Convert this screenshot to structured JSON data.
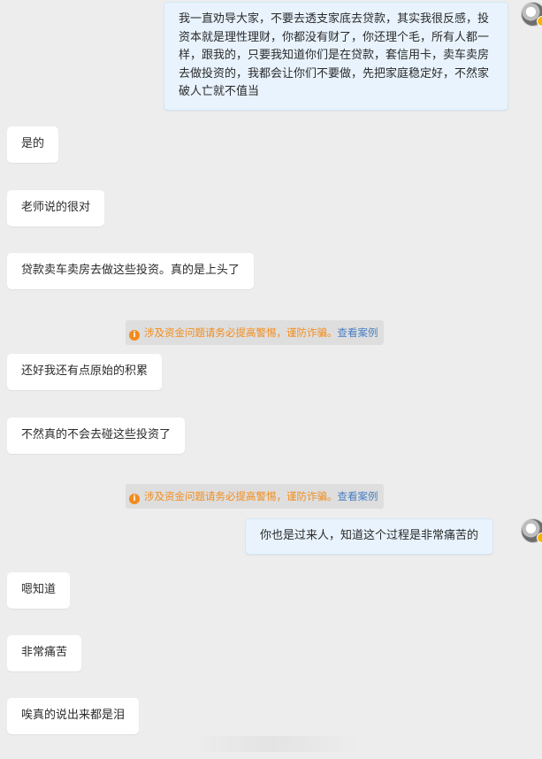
{
  "messages": [
    {
      "side": "right",
      "text": "我一直劝导大家，不要去透支家底去贷款，其实我很反感，投资本就是理性理财，你都没有财了，你还理个毛，所有人都一样，跟我的，只要我知道你们是在贷款，套信用卡，卖车卖房去做投资的，我都会让你们不要做，先把家庭稳定好，不然家破人亡就不值当"
    },
    {
      "side": "left",
      "text": "是的"
    },
    {
      "side": "left",
      "text": "老师说的很对"
    },
    {
      "side": "left",
      "text": "贷款卖车卖房去做这些投资。真的是上头了"
    },
    {
      "side": "left",
      "text": "还好我还有点原始的积累"
    },
    {
      "side": "left",
      "text": "不然真的不会去碰这些投资了"
    },
    {
      "side": "right",
      "text": "你也是过来人，知道这个过程是非常痛苦的"
    },
    {
      "side": "left",
      "text": "嗯知道"
    },
    {
      "side": "left",
      "text": "非常痛苦"
    },
    {
      "side": "left",
      "text": "唉真的说出来都是泪"
    }
  ],
  "notice": {
    "text": "涉及资金问题请务必提高警惕，谨防诈骗。",
    "link": "查看案例",
    "icon": "info-icon",
    "color": "#f28c1c",
    "link_color": "#4a7fc1"
  },
  "colors": {
    "background": "#ededed",
    "left_bubble": "#ffffff",
    "right_bubble": "#e8f3fd"
  }
}
